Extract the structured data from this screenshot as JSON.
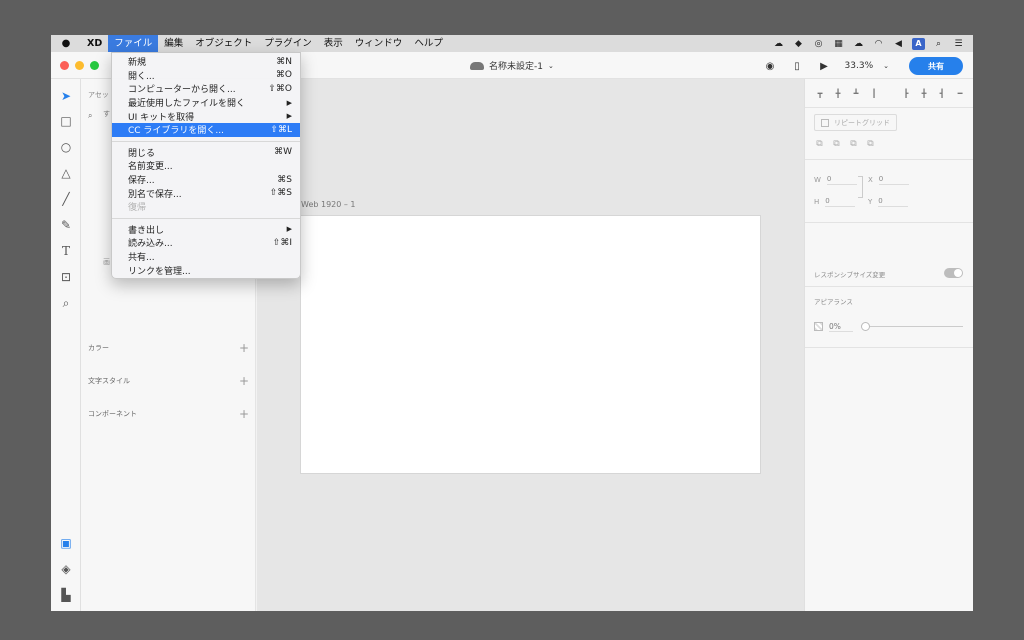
{
  "menubar": {
    "app": "XD",
    "items": [
      "ファイル",
      "編集",
      "オブジェクト",
      "プラグイン",
      "表示",
      "ウィンドウ",
      "ヘルプ"
    ],
    "status_a": "A"
  },
  "titlebar": {
    "doc_name": "名称未設定-1",
    "zoom": "33.3%",
    "share": "共有"
  },
  "file_menu": {
    "group1": [
      {
        "label": "新規",
        "shortcut": "⌘N"
      },
      {
        "label": "開く...",
        "shortcut": "⌘O"
      },
      {
        "label": "コンピューターから開く...",
        "shortcut": "⇧⌘O"
      },
      {
        "label": "最近使用したファイルを開く",
        "shortcut": "▶"
      },
      {
        "label": "UI キットを取得",
        "shortcut": "▶"
      },
      {
        "label": "CC ライブラリを開く...",
        "shortcut": "⇧⌘L"
      }
    ],
    "group2": [
      {
        "label": "閉じる",
        "shortcut": "⌘W"
      },
      {
        "label": "名前変更...",
        "shortcut": ""
      },
      {
        "label": "保存...",
        "shortcut": "⌘S"
      },
      {
        "label": "別名で保存...",
        "shortcut": "⇧⌘S"
      },
      {
        "label": "復帰",
        "shortcut": ""
      }
    ],
    "group3": [
      {
        "label": "書き出し",
        "shortcut": "▶"
      },
      {
        "label": "読み込み...",
        "shortcut": "⇧⌘I"
      },
      {
        "label": "共有...",
        "shortcut": ""
      },
      {
        "label": "リンクを管理...",
        "shortcut": ""
      }
    ]
  },
  "assets": {
    "title": "アセッ",
    "search_placeholder": "す",
    "empty_hint": "画",
    "sections": [
      "カラー",
      "文字スタイル",
      "コンポーネント"
    ]
  },
  "canvas": {
    "artboard_label": "Web 1920 – 1"
  },
  "inspector": {
    "repeat_grid": "リピートグリッド",
    "w_label": "W",
    "w_value": "0",
    "x_label": "X",
    "x_value": "0",
    "h_label": "H",
    "h_value": "0",
    "y_label": "Y",
    "y_value": "0",
    "responsive_resize": "レスポンシブサイズ変更",
    "appearance": "アピアランス",
    "opacity": "0%"
  }
}
